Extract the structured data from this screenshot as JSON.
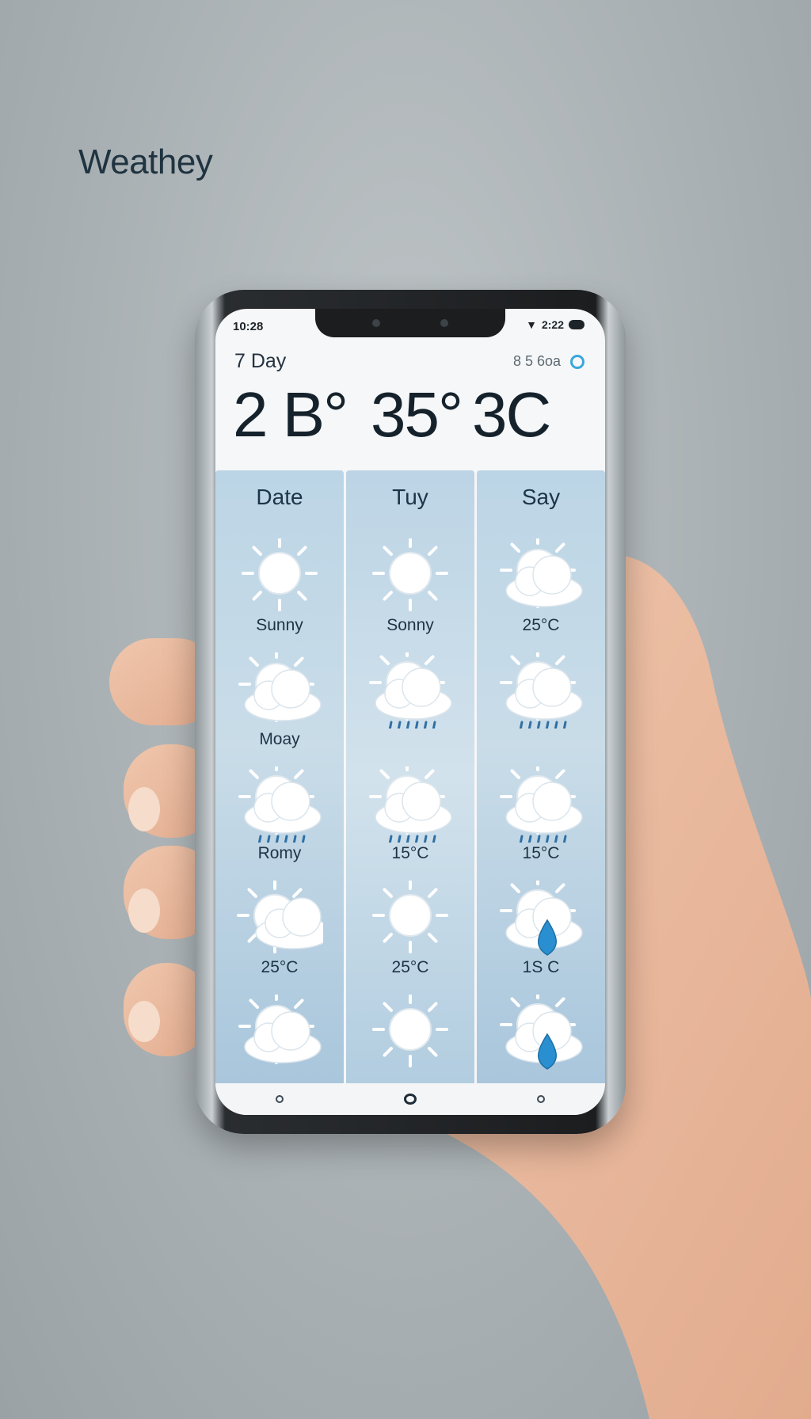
{
  "app": {
    "brand": "Weathey"
  },
  "status": {
    "time": "10:28",
    "right": "2:22"
  },
  "header": {
    "subtitle": "7 Day",
    "right_text": "8 5 6oa",
    "temps": [
      "2 B°",
      "35°",
      "3C"
    ]
  },
  "forecast": {
    "columns": [
      {
        "label": "Date",
        "cells": [
          {
            "icon": "sun-icon",
            "text": "Sunny"
          },
          {
            "icon": "partly-cloudy-icon",
            "text": "Moay"
          },
          {
            "icon": "rain-icon",
            "text": "Romy"
          },
          {
            "icon": "sun-cloud-icon",
            "text": "25°C"
          },
          {
            "icon": "partly-cloudy-icon",
            "text": ""
          }
        ]
      },
      {
        "label": "Tuy",
        "cells": [
          {
            "icon": "sun-icon",
            "text": "Sonny"
          },
          {
            "icon": "rain-icon",
            "text": ""
          },
          {
            "icon": "rain-icon",
            "text": "15°C"
          },
          {
            "icon": "sun-icon",
            "text": "25°C"
          },
          {
            "icon": "sun-icon",
            "text": ""
          }
        ]
      },
      {
        "label": "Say",
        "cells": [
          {
            "icon": "partly-cloudy-icon",
            "text": "25°C"
          },
          {
            "icon": "rain-icon",
            "text": ""
          },
          {
            "icon": "rain-icon",
            "text": "15°C"
          },
          {
            "icon": "drop-cloud-icon",
            "text": "1S C"
          },
          {
            "icon": "drop-cloud-icon",
            "text": ""
          }
        ]
      }
    ]
  },
  "colors": {
    "accent": "#39a7dc",
    "panel": "#bcd5e6",
    "text": "#1d3346"
  }
}
